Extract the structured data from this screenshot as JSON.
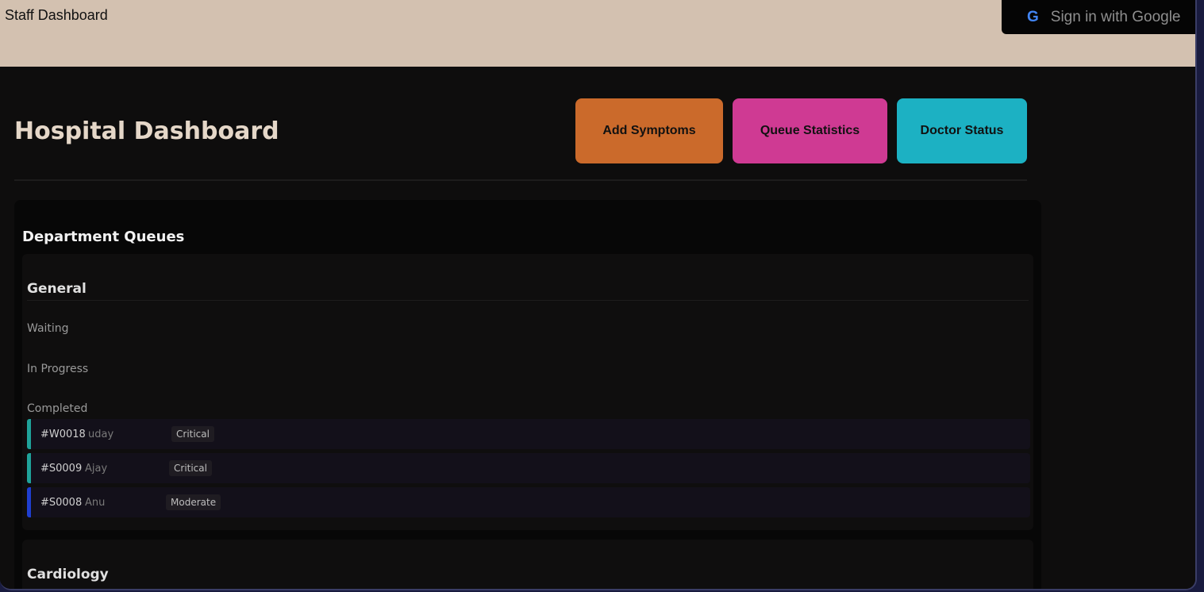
{
  "topbar": {
    "title": "Staff Dashboard",
    "signin_label": "Sign in with Google",
    "signin_icon": "google-g-icon"
  },
  "header": {
    "title": "Hospital Dashboard",
    "buttons": {
      "add_symptoms": "Add Symptoms",
      "queue_statistics": "Queue Statistics",
      "doctor_status": "Doctor Status"
    }
  },
  "colors": {
    "add_symptoms": "#cb6a2b",
    "queue_statistics": "#cf3a93",
    "doctor_status": "#1cb1c3",
    "topbar": "#d3c1b0",
    "critical_bar": "#1fa39a",
    "moderate_bar": "#1f3fd0"
  },
  "queues": {
    "title": "Department Queues",
    "departments": [
      {
        "name": "General",
        "statuses": {
          "waiting": "Waiting",
          "in_progress": "In Progress",
          "completed": "Completed"
        },
        "completed": [
          {
            "id": "#W0018",
            "name": "uday",
            "severity": "Critical"
          },
          {
            "id": "#S0009",
            "name": "Ajay",
            "severity": "Critical"
          },
          {
            "id": "#S0008",
            "name": "Anu",
            "severity": "Moderate"
          }
        ]
      },
      {
        "name": "Cardiology"
      }
    ]
  }
}
